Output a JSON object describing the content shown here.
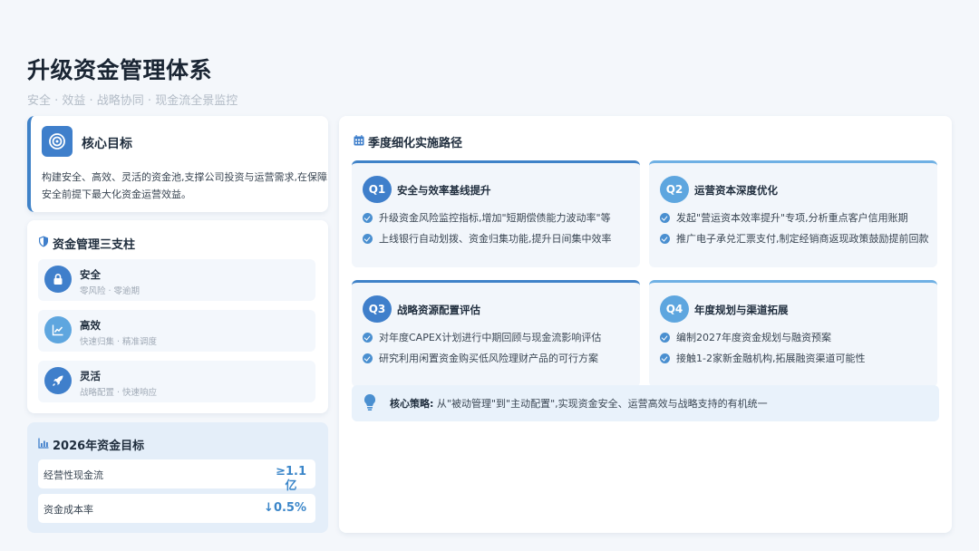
{
  "header": {
    "title": "升级资金管理体系",
    "subtitle": "安全 · 效益 · 战略协同 · 现金流全景监控"
  },
  "core_goal": {
    "icon": "target-icon",
    "title": "核心目标",
    "description": "构建安全、高效、灵活的资金池,支撑公司投资与运营需求,在保障安全前提下最大化资金运营效益。"
  },
  "pillars": {
    "icon": "shield-icon",
    "title": "资金管理三支柱",
    "items": [
      {
        "name": "安全",
        "sub": "零风险 · 零逾期",
        "icon": "lock-icon",
        "color": "#3f7fcb"
      },
      {
        "name": "高效",
        "sub": "快速归集 · 精准调度",
        "icon": "chart-line-icon",
        "color": "#5ea6df"
      },
      {
        "name": "灵活",
        "sub": "战略配置 · 快速响应",
        "icon": "rocket-icon",
        "color": "#3f7fcb"
      }
    ]
  },
  "targets": {
    "icon": "bar-chart-icon",
    "title": "2026年资金目标",
    "rows": [
      {
        "label": "经营性现金流",
        "value_line1": "≥1.1",
        "value_line2": "亿"
      },
      {
        "label": "资金成本率",
        "value_line1": "↓0.5%",
        "value_line2": ""
      }
    ]
  },
  "roadmap": {
    "icon": "calendar-icon",
    "title": "季度细化实施路径",
    "quarters": [
      {
        "badge": "Q1",
        "title": "安全与效率基线提升",
        "color": "#3f7fcb",
        "items": [
          "升级资金风险监控指标,增加\"短期偿债能力波动率\"等",
          "上线银行自动划拨、资金归集功能,提升日间集中效率"
        ]
      },
      {
        "badge": "Q2",
        "title": "运营资本深度优化",
        "color": "#5ea6df",
        "items": [
          "发起\"营运资本效率提升\"专项,分析重点客户信用账期",
          "推广电子承兑汇票支付,制定经销商返现政策鼓励提前回款"
        ]
      },
      {
        "badge": "Q3",
        "title": "战略资源配置评估",
        "color": "#3f7fcb",
        "items": [
          "对年度CAPEX计划进行中期回顾与现金流影响评估",
          "研究利用闲置资金购买低风险理财产品的可行方案"
        ]
      },
      {
        "badge": "Q4",
        "title": "年度规划与渠道拓展",
        "color": "#5ea6df",
        "items": [
          "编制2027年度资金规划与融资预案",
          "接触1-2家新金融机构,拓展融资渠道可能性"
        ]
      }
    ],
    "strategy": {
      "icon": "lightbulb-icon",
      "label": "核心策略:",
      "text": " 从\"被动管理\"到\"主动配置\",实现资金安全、运营高效与战略支持的有机统一"
    }
  }
}
